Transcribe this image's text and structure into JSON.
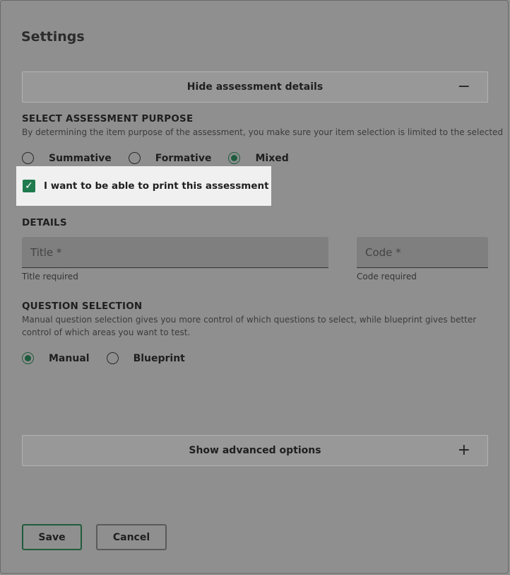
{
  "dialog": {
    "title": "Settings"
  },
  "assessment_details": {
    "toggle_label": "Hide assessment details",
    "toggle_sign": "−"
  },
  "purpose": {
    "heading": "SELECT ASSESSMENT PURPOSE",
    "help": "By determining the item purpose of the assessment, you make sure your item selection is limited to the selected",
    "options": [
      "Summative",
      "Formative",
      "Mixed"
    ],
    "selected": "Mixed"
  },
  "print": {
    "label": "I want to be able to print this assessment",
    "checked": true,
    "check_glyph": "✓"
  },
  "details": {
    "heading": "DETAILS",
    "title_placeholder": "Title *",
    "title_help": "Title required",
    "code_placeholder": "Code *",
    "code_help": "Code required"
  },
  "question_selection": {
    "heading": "QUESTION SELECTION",
    "help": "Manual question selection gives you more control of which questions to select, while blueprint gives better control of which areas you want to test.",
    "options": [
      "Manual",
      "Blueprint"
    ],
    "selected": "Manual"
  },
  "advanced": {
    "toggle_label": "Show advanced options",
    "toggle_sign": "+"
  },
  "actions": {
    "save_label": "Save",
    "cancel_label": "Cancel"
  },
  "colors": {
    "accent": "#1f5c3d",
    "checkbox": "#1f7a4d",
    "overlay": "#8f8f8f",
    "highlight": "#f0f0f0"
  }
}
